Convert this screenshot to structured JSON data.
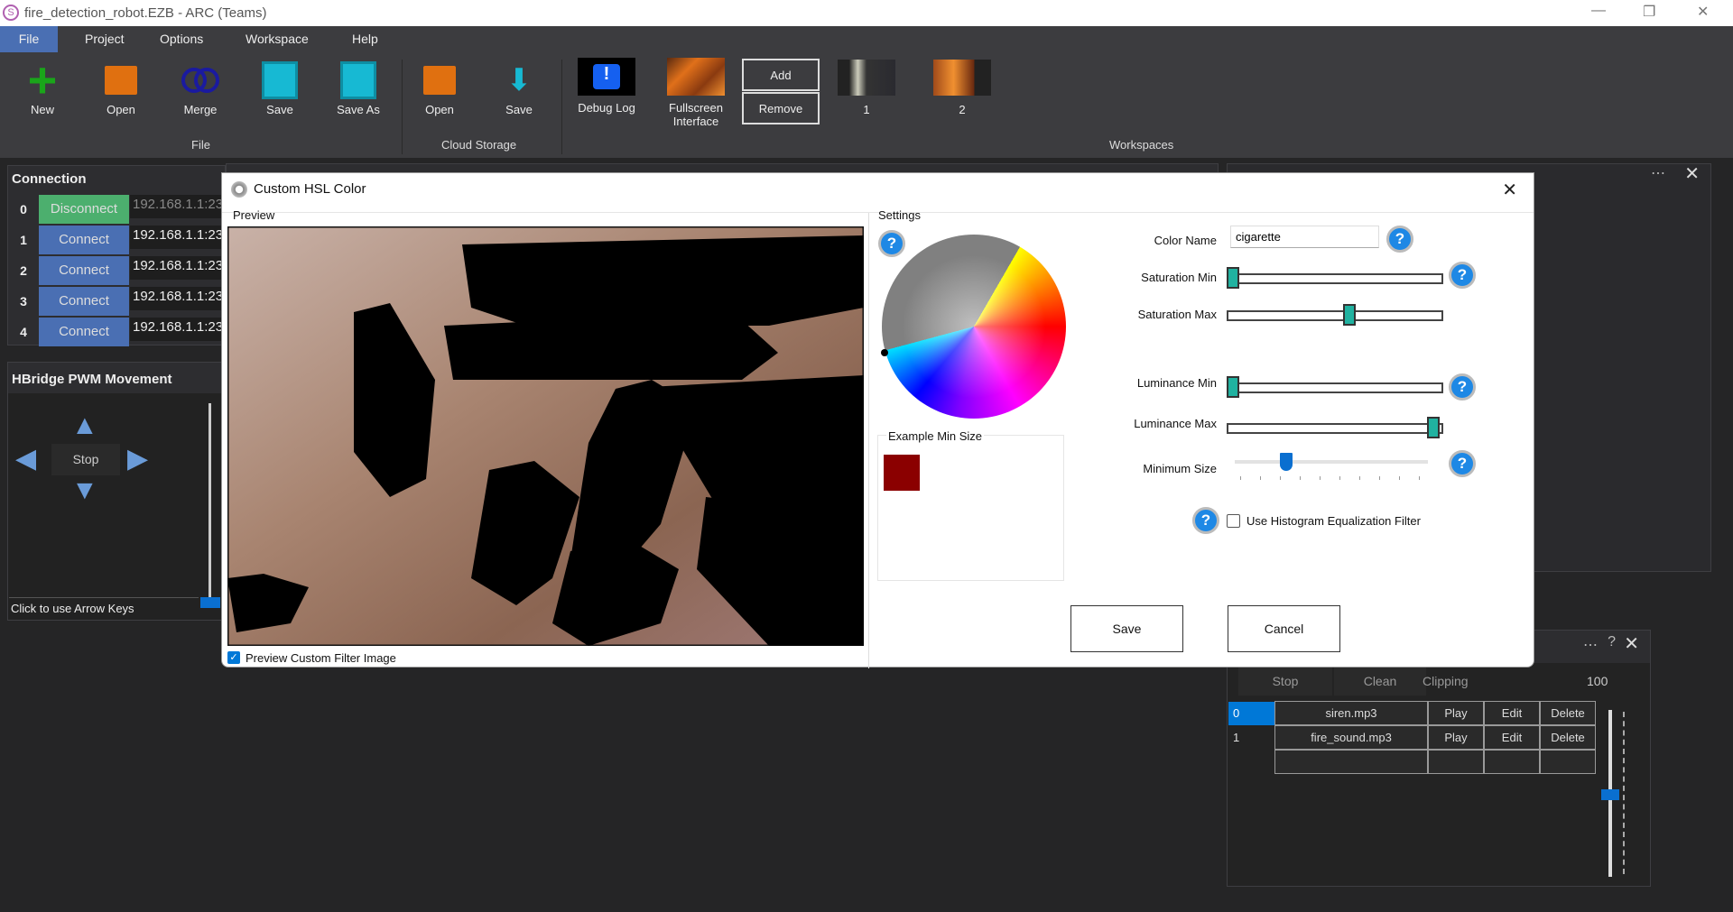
{
  "window": {
    "title": "fire_detection_robot.EZB - ARC (Teams)",
    "logo": "S"
  },
  "menu": [
    "File",
    "Project",
    "Options",
    "Workspace",
    "Help"
  ],
  "ribbon": {
    "file_buttons": [
      {
        "label": "New",
        "icon": "plus-icon"
      },
      {
        "label": "Open",
        "icon": "folder-icon"
      },
      {
        "label": "Merge",
        "icon": "merge-icon"
      },
      {
        "label": "Save",
        "icon": "floppy-icon"
      },
      {
        "label": "Save As",
        "icon": "floppy-icon"
      }
    ],
    "file_group": "File",
    "cloud_buttons": [
      {
        "label": "Open",
        "icon": "folder-icon"
      },
      {
        "label": "Save",
        "icon": "download-icon"
      }
    ],
    "cloud_group": "Cloud Storage",
    "debug_log": "Debug Log",
    "fullscreen": "Fullscreen Interface",
    "add": "Add",
    "remove": "Remove",
    "workspace_1": "1",
    "workspace_2": "2",
    "workspaces_group": "Workspaces"
  },
  "connection": {
    "title": "Connection",
    "rows": [
      {
        "index": "0",
        "button": "Disconnect",
        "ip": "192.168.1.1:23",
        "connected": true
      },
      {
        "index": "1",
        "button": "Connect",
        "ip": "192.168.1.1:23"
      },
      {
        "index": "2",
        "button": "Connect",
        "ip": "192.168.1.1:23"
      },
      {
        "index": "3",
        "button": "Connect",
        "ip": "192.168.1.1:23"
      },
      {
        "index": "4",
        "button": "Connect",
        "ip": "192.168.1.1:23"
      }
    ]
  },
  "hbridge": {
    "title": "HBridge PWM Movement",
    "stop": "Stop",
    "arrow_keys": "Click to use Arrow Keys"
  },
  "dialog": {
    "title": "Custom HSL Color",
    "preview_label": "Preview",
    "preview_checkbox": "Preview Custom Filter Image",
    "preview_checked": true,
    "settings_label": "Settings",
    "example_min_size": "Example Min Size",
    "example_color": "#8b0000",
    "color_name_label": "Color Name",
    "color_name_value": "cigarette",
    "saturation_min_label": "Saturation Min",
    "saturation_min": 0,
    "saturation_max_label": "Saturation Max",
    "saturation_max": 0.58,
    "luminance_min_label": "Luminance Min",
    "luminance_min": 0,
    "luminance_max_label": "Luminance Max",
    "luminance_max": 1,
    "minimum_size_label": "Minimum Size",
    "minimum_size": 0.25,
    "histogram_label": "Use Histogram Equalization Filter",
    "histogram_checked": false,
    "save": "Save",
    "cancel": "Cancel",
    "slider_color": "#20b2a0"
  },
  "sound": {
    "header": [
      "Stop",
      "Clean",
      "Clipping",
      "100"
    ],
    "rows": [
      {
        "index": "0",
        "file": "siren.mp3",
        "play": "Play",
        "edit": "Edit",
        "delete": "Delete"
      },
      {
        "index": "1",
        "file": "fire_sound.mp3",
        "play": "Play",
        "edit": "Edit",
        "delete": "Delete"
      }
    ]
  },
  "colors": {
    "accent": "#0078d7",
    "connect": "#4a6fb3",
    "disconnect": "#4caf6e"
  }
}
